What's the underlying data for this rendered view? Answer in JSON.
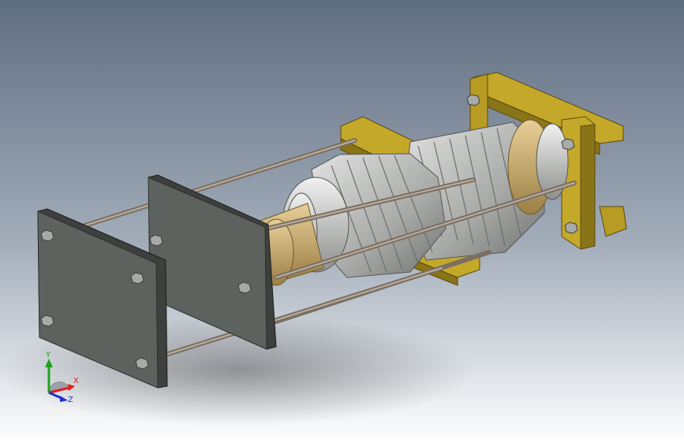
{
  "scene": {
    "type": "cad-3d-assembly-view",
    "background_top": "#5f6d80",
    "background_bottom": "#ffffff",
    "colors": {
      "plate": "#5e625e",
      "plate_edge": "#2c2f2c",
      "yellow_block": "#c4a82a",
      "yellow_dark": "#8a7418",
      "rod": "#7a6f62",
      "gear_light": "#c9cac9",
      "gear_dark": "#8d8f8d",
      "bearing_tan": "#d4b57a",
      "bearing_silver": "#c7c8c6",
      "coupling_red": "#c51414",
      "nut": "#a8aaa8"
    }
  },
  "triad": {
    "x_label": "X",
    "y_label": "Y",
    "z_label": "Z",
    "x_color": "#e02020",
    "y_color": "#20a020",
    "z_color": "#2030d0"
  }
}
